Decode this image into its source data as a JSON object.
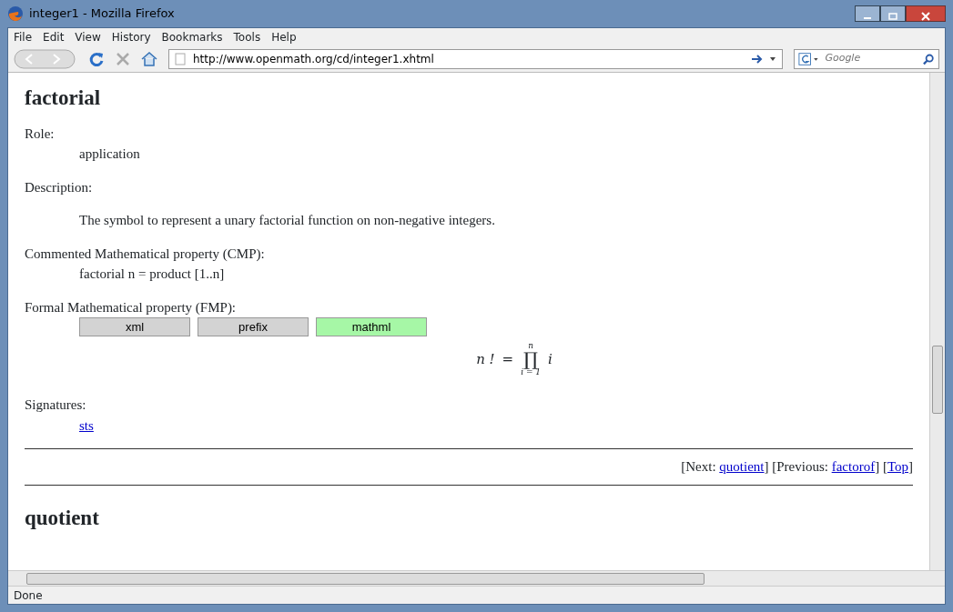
{
  "window": {
    "title": "integer1 - Mozilla Firefox"
  },
  "menu": [
    "File",
    "Edit",
    "View",
    "History",
    "Bookmarks",
    "Tools",
    "Help"
  ],
  "toolbar": {
    "url": "http://www.openmath.org/cd/integer1.xhtml",
    "search_placeholder": "Google"
  },
  "content": {
    "heading": "factorial",
    "sections": [
      {
        "kind": "text",
        "title": "Role:",
        "body": "application"
      },
      {
        "kind": "para",
        "title": "Description:",
        "body": "The symbol to represent a unary factorial function on non-negative integers."
      },
      {
        "kind": "text",
        "title": "Commented Mathematical property (CMP):",
        "body": "factorial n = product [1..n]"
      },
      {
        "kind": "fmp",
        "title": "Formal Mathematical property (FMP):",
        "tabs": [
          {
            "label": "xml",
            "selected": false
          },
          {
            "label": "prefix",
            "selected": false
          },
          {
            "label": "mathml",
            "selected": true
          }
        ],
        "formula": {
          "lhs": "n !",
          "eq": "=",
          "op": "∏",
          "upper": "n",
          "lower": "i = 1",
          "body": "i"
        }
      },
      {
        "kind": "link",
        "title": "Signatures:",
        "body": "sts"
      }
    ],
    "nav": [
      {
        "prefix": "[Next: ",
        "link": "quotient",
        "suffix": "]"
      },
      {
        "prefix": " [Previous: ",
        "link": "factorof",
        "suffix": "]"
      },
      {
        "prefix": " [",
        "link": "Top",
        "suffix": "]"
      }
    ],
    "next_heading": "quotient"
  },
  "status_bar": "Done"
}
